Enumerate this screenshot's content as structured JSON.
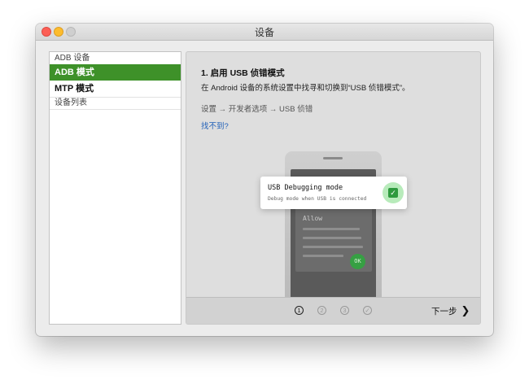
{
  "window": {
    "title": "设备"
  },
  "sidebar": {
    "header": "ADB 设备",
    "items": [
      {
        "label": "ADB 模式",
        "active": true
      },
      {
        "label": "MTP 模式",
        "active": false
      }
    ],
    "footer": "设备列表"
  },
  "main": {
    "step_title": "1. 启用 USB 侦错模式",
    "step_desc": "在 Android 设备的系统设置中找寻和切换到“USB 侦错模式”。",
    "path": "设置 → 开发者选项 → USB 侦错",
    "not_found_link": "找不到?",
    "illustration": {
      "dialog_text": "Allow",
      "ok_label": "OK",
      "toast_title": "USB Debugging mode",
      "toast_subtitle": "Debug mode when USB is connected",
      "toast_checked": true
    },
    "footer": {
      "steps": [
        "1",
        "2",
        "3",
        "✓"
      ],
      "current_step": 1,
      "next_label": "下一步",
      "next_icon": "chevron-right-icon"
    }
  },
  "colors": {
    "accent_green": "#3e9129",
    "link_blue": "#1f5fb8",
    "check_green": "#2e9a3e"
  }
}
